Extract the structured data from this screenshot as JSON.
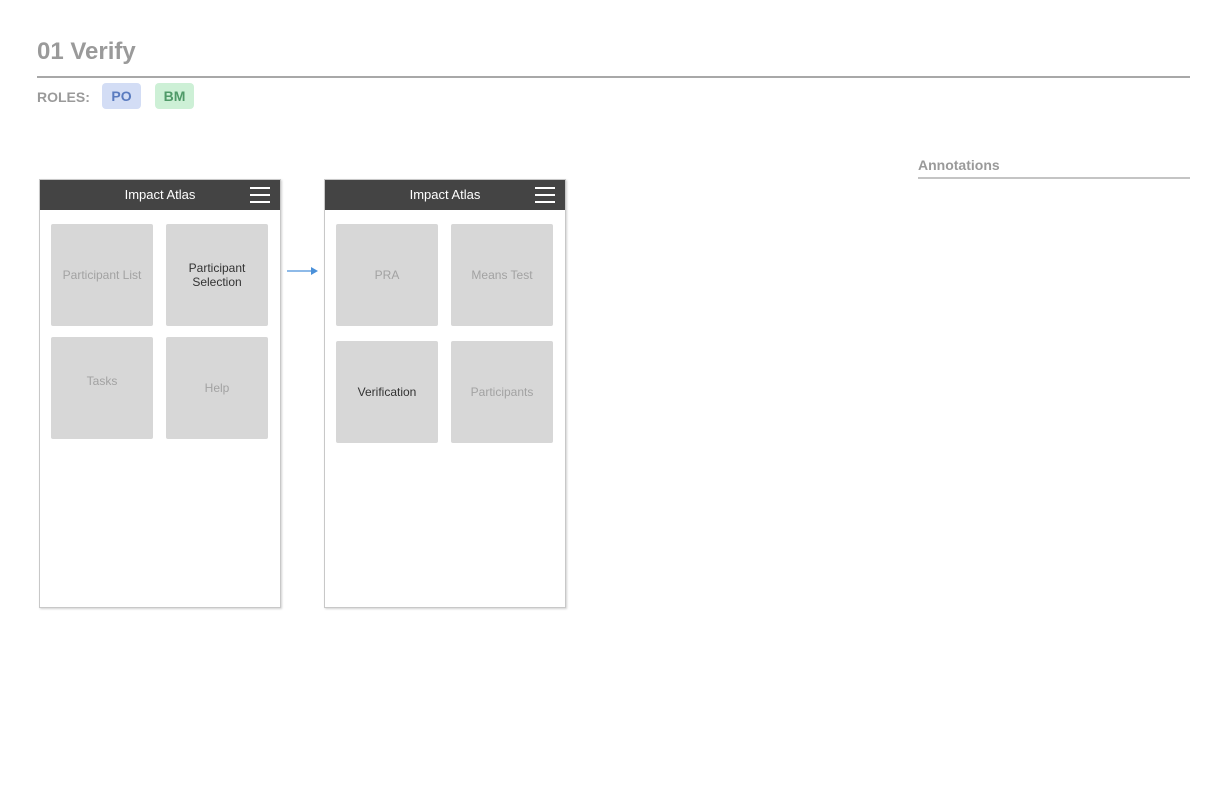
{
  "page": {
    "title": "01 Verify",
    "roles_label": "ROLES:"
  },
  "roles": [
    {
      "label": "PO",
      "color": "#d3ddf5"
    },
    {
      "label": "BM",
      "color": "#cdf0d6"
    }
  ],
  "annotations": {
    "heading": "Annotations"
  },
  "screens": [
    {
      "app_title": "Impact Atlas",
      "menu_icon": "hamburger-menu-icon",
      "tiles": [
        {
          "label": "Participant List",
          "active": false
        },
        {
          "label": "Participant Selection",
          "active": true
        },
        {
          "label": "Tasks",
          "active": false
        },
        {
          "label": "Help",
          "active": false
        }
      ]
    },
    {
      "app_title": "Impact Atlas",
      "menu_icon": "hamburger-menu-icon",
      "tiles": [
        {
          "label": "PRA",
          "active": false
        },
        {
          "label": "Means Test",
          "active": false
        },
        {
          "label": "Verification",
          "active": true
        },
        {
          "label": "Participants",
          "active": false
        }
      ]
    }
  ],
  "flow": {
    "arrow_color": "#4a90d9"
  }
}
